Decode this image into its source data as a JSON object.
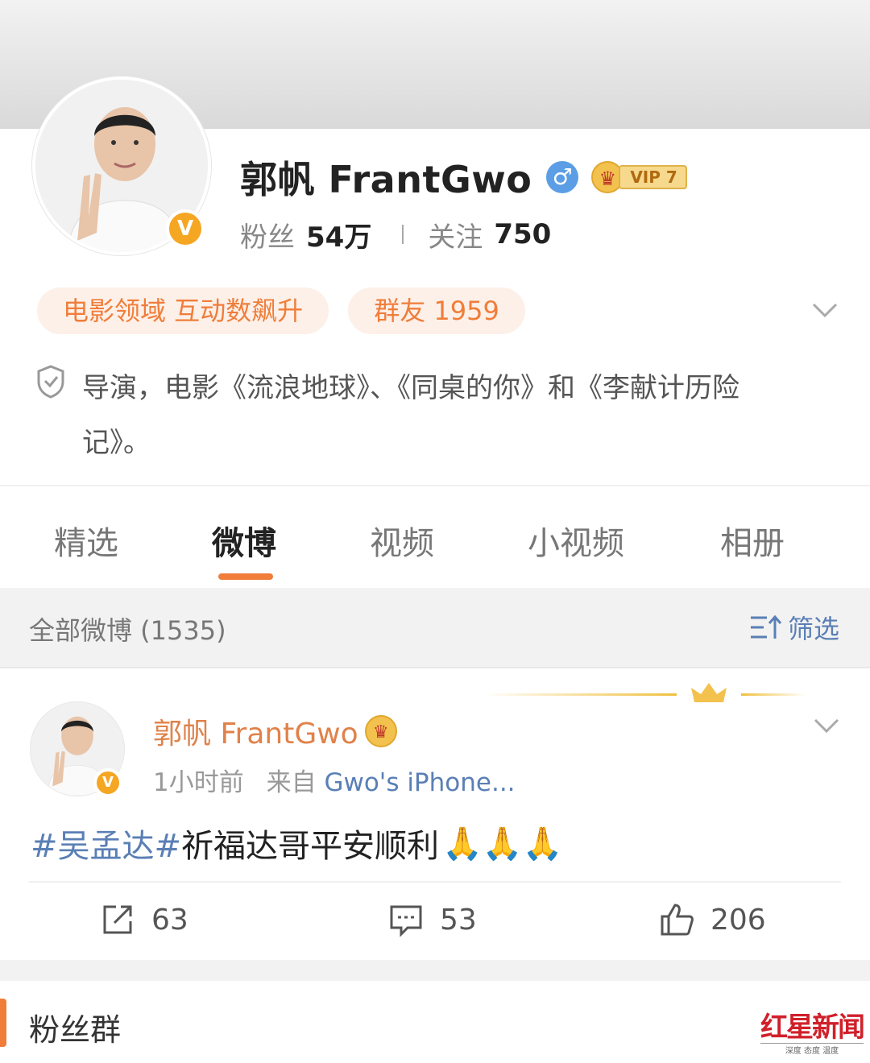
{
  "profile": {
    "name": "郭帆 FrantGwo",
    "gender_symbol": "♂",
    "vip_label": "VIP 7",
    "verified_symbol": "V",
    "fans_label": "粉丝",
    "fans_value": "54万",
    "follow_label": "关注",
    "follow_value": "750",
    "tags": [
      "电影领域 互动数飙升",
      "群友 1959"
    ],
    "bio_line1": "导演，电影《流浪地球》、《同桌的你》和《李献计历险",
    "bio_line2": "记》。"
  },
  "tabs": [
    {
      "label": "精选",
      "active": false
    },
    {
      "label": "微博",
      "active": true
    },
    {
      "label": "视频",
      "active": false
    },
    {
      "label": "小视频",
      "active": false
    },
    {
      "label": "相册",
      "active": false
    }
  ],
  "filter_bar": {
    "all_label": "全部微博 (1535)",
    "filter_label": "筛选"
  },
  "post": {
    "author": "郭帆 FrantGwo",
    "time": "1小时前",
    "from_label": "来自",
    "source": "Gwo's iPhone...",
    "hashtag": "#吴孟达#",
    "text": "祈福达哥平安顺利",
    "emoji": "🙏🙏🙏",
    "reposts": "63",
    "comments": "53",
    "likes": "206"
  },
  "fans_section": {
    "title": "粉丝群"
  },
  "watermark": {
    "main": "红星新闻",
    "sub": "深度 态度 温度"
  },
  "colors": {
    "accent_orange": "#f07d3a",
    "link_blue": "#5a7fb5",
    "verified_gold": "#f5a623"
  }
}
